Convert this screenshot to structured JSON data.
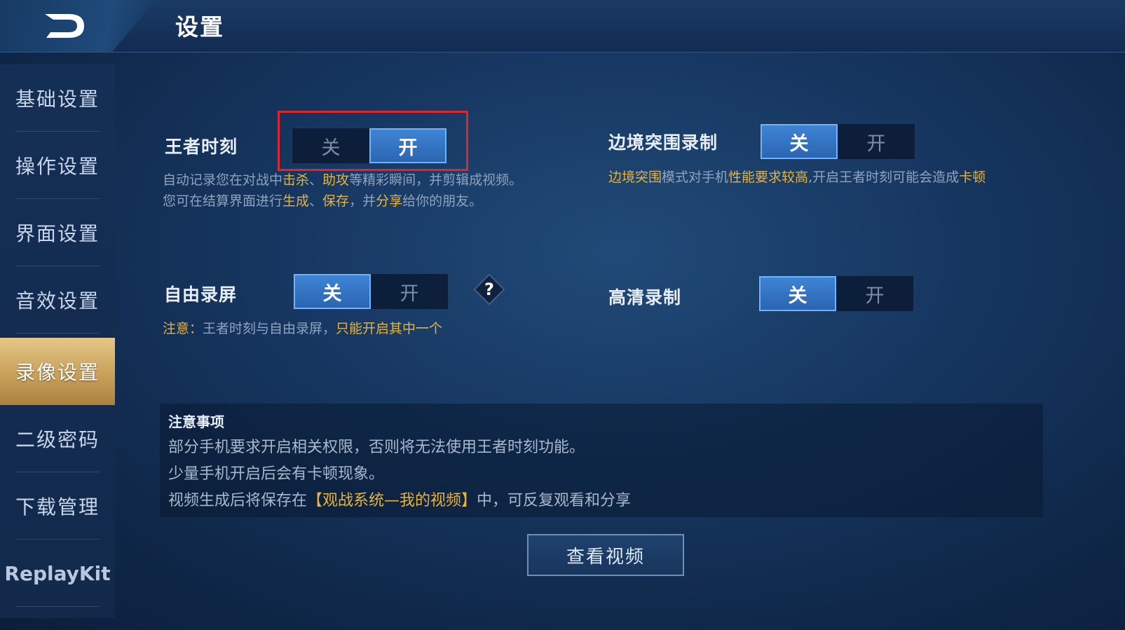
{
  "header": {
    "title": "设置",
    "back_icon": "back-arrow-icon"
  },
  "sidebar": {
    "items": [
      {
        "label": "基础设置",
        "active": false
      },
      {
        "label": "操作设置",
        "active": false
      },
      {
        "label": "界面设置",
        "active": false
      },
      {
        "label": "音效设置",
        "active": false
      },
      {
        "label": "录像设置",
        "active": true
      },
      {
        "label": "二级密码",
        "active": false
      },
      {
        "label": "下载管理",
        "active": false
      },
      {
        "label": "ReplayKit",
        "active": false
      }
    ]
  },
  "settings": {
    "king_moment": {
      "label": "王者时刻",
      "off": "关",
      "on": "开",
      "selected": "on",
      "desc_line1": {
        "p1": "自动记录您在对战中",
        "h1": "击杀",
        "p2": "、",
        "h2": "助攻",
        "p3": "等精彩瞬间，并剪辑成视频。"
      },
      "desc_line2": {
        "p1": "您可在结算界面进行",
        "h1": "生成",
        "p2": "、",
        "h2": "保存",
        "p3": "，并",
        "h3": "分享",
        "p4": "给你的朋友。"
      }
    },
    "border_siege": {
      "label": "边境突围录制",
      "off": "关",
      "on": "开",
      "selected": "off",
      "desc": {
        "h1": "边境突围",
        "p1": "模式对手机",
        "h2": "性能要求较高",
        "p2": ",开启王者时刻可能会造成",
        "h3": "卡顿"
      }
    },
    "free_record": {
      "label": "自由录屏",
      "off": "关",
      "on": "开",
      "selected": "off",
      "help": "?",
      "note": {
        "h1": "注意：",
        "p1": "王者时刻与自由录屏，",
        "h2": "只能开启其中一个"
      }
    },
    "hd_record": {
      "label": "高清录制",
      "off": "关",
      "on": "开",
      "selected": "off"
    }
  },
  "notice": {
    "title": "注意事项",
    "line1": "部分手机要求开启相关权限，否则将无法使用王者时刻功能。",
    "line2": "少量手机开启后会有卡顿现象。",
    "line3": {
      "p1": "视频生成后将保存在",
      "h1": "【观战系统—我的视频】",
      "p2": "中，可反复观看和分享"
    }
  },
  "view_button": "查看视频",
  "colors": {
    "highlight": "#e7b33a",
    "toggle_on": "#2f6fbf",
    "sidebar_active": "#c9a05a",
    "annotation_box": "#e0262c"
  }
}
